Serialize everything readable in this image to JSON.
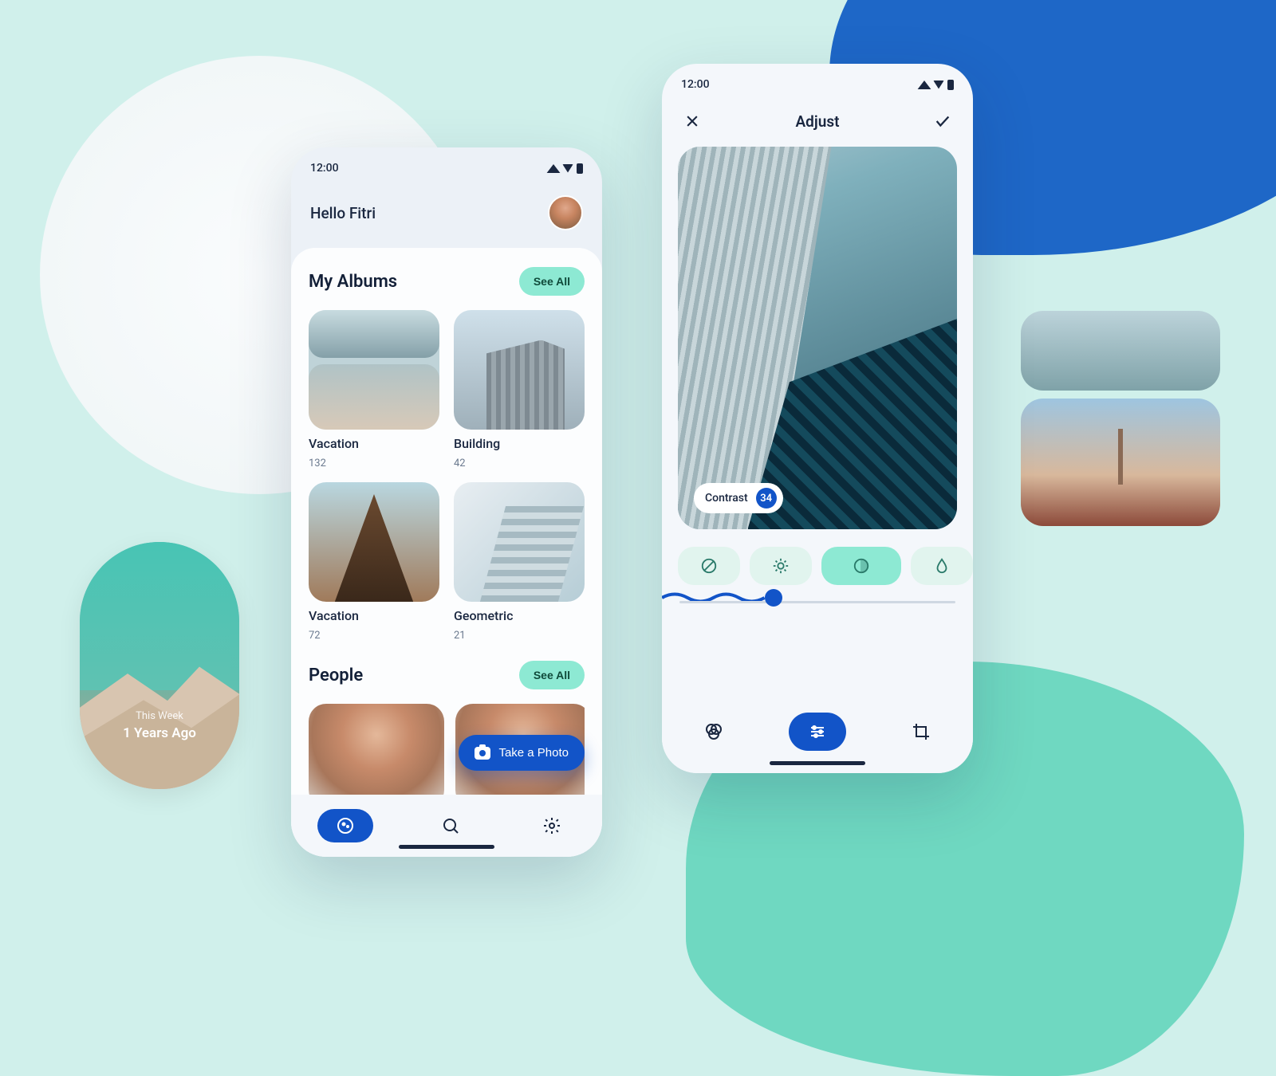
{
  "status": {
    "time": "12:00"
  },
  "home": {
    "greeting": "Hello Fitri",
    "sections": {
      "albums_title": "My Albums",
      "people_title": "People",
      "see_all_label": "See All"
    },
    "albums": [
      {
        "name": "Vacation",
        "count": "132"
      },
      {
        "name": "Building",
        "count": "42"
      },
      {
        "name": "Vacation",
        "count": "72"
      },
      {
        "name": "Geometric",
        "count": "21"
      }
    ],
    "fab_label": "Take a Photo"
  },
  "adjust": {
    "title": "Adjust",
    "contrast_label": "Contrast",
    "contrast_value": "34",
    "slider_percent": 33
  },
  "memory": {
    "label": "This Week",
    "title": "1 Years Ago"
  },
  "colors": {
    "accent": "#1254c8",
    "mint": "#8de9d3",
    "teal_bg": "#d0f0eb"
  }
}
